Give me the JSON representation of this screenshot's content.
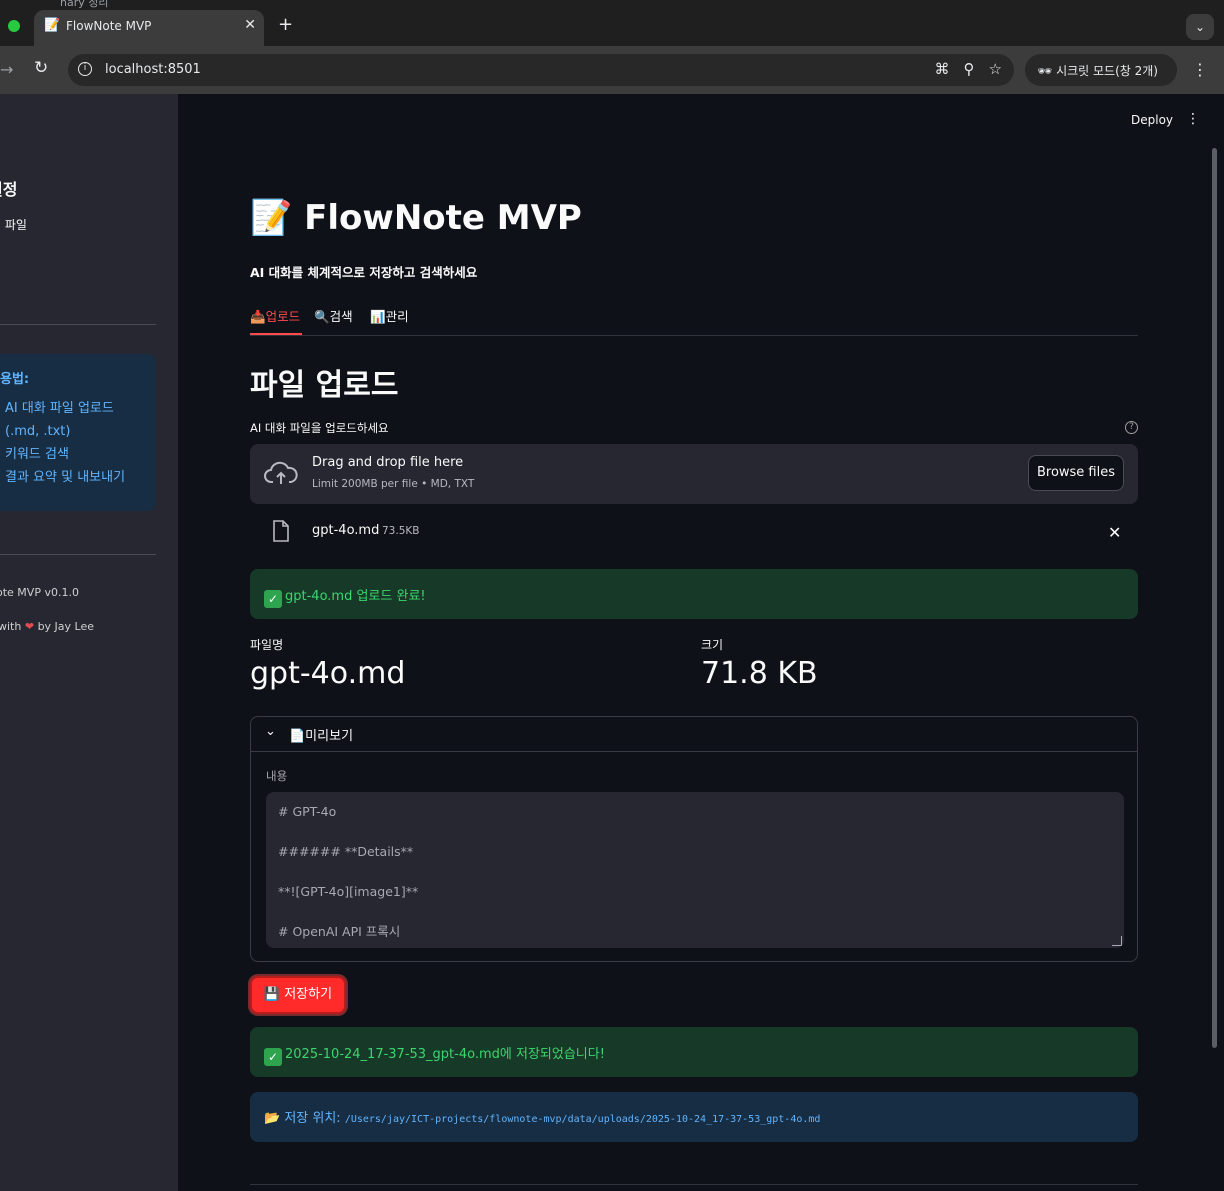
{
  "browser": {
    "tab_title": "FlowNote MVP",
    "tab_icon": "📝",
    "strip_text": "nary  정리",
    "url": "localhost:8501",
    "incognito_label": "시크릿 모드(창 2개)"
  },
  "sidebar": {
    "title": "설정",
    "subtitle": "된 파일",
    "info": {
      "heading": "용법:",
      "items": [
        "AI 대화 파일 업로드",
        "(.md, .txt)",
        "키워드 검색",
        "결과 요약 및 내보내기"
      ]
    },
    "version": "ote MVP v0.1.0",
    "made_prefix": "with",
    "made_suffix": "by Jay Lee"
  },
  "header": {
    "deploy_label": "Deploy"
  },
  "main": {
    "title": "📝 FlowNote MVP",
    "subtitle": "AI 대화를 체계적으로 저장하고 검색하세요",
    "tabs": [
      {
        "label": "📥업로드"
      },
      {
        "label": "🔍검색"
      },
      {
        "label": "📊관리"
      }
    ],
    "section_title": "파일 업로드",
    "uploader": {
      "label": "AI 대화 파일을 업로드하세요",
      "drag_text": "Drag and drop file here",
      "limit_text": "Limit 200MB per file • MD, TXT",
      "browse_label": "Browse files"
    },
    "file": {
      "name": "gpt-4o.md",
      "size": "73.5KB"
    },
    "upload_success": "gpt-4o.md 업로드 완료!",
    "metrics": [
      {
        "label": "파일명",
        "value": "gpt-4o.md"
      },
      {
        "label": "크기",
        "value": "71.8 KB"
      }
    ],
    "preview": {
      "title": "📄미리보기",
      "content_label": "내용",
      "lines": [
        "# GPT-4o",
        "###### **Details**",
        "**![GPT-4o][image1]**",
        "# OpenAI API 프록시"
      ]
    },
    "save_label": "💾 저장하기",
    "save_success": "2025-10-24_17-37-53_gpt-4o.md에 저장되었습니다!",
    "save_location_label": "📂 저장 위치:",
    "save_path": "/Users/jay/ICT-projects/flownote-mvp/data/uploads/2025-10-24_17-37-53_gpt-4o.md"
  },
  "colors": {
    "accent": "#ff4b4b",
    "success_bg": "#173928",
    "success_text": "#3dd56d",
    "info_bg": "#172d43",
    "info_text": "#60b4ff"
  }
}
